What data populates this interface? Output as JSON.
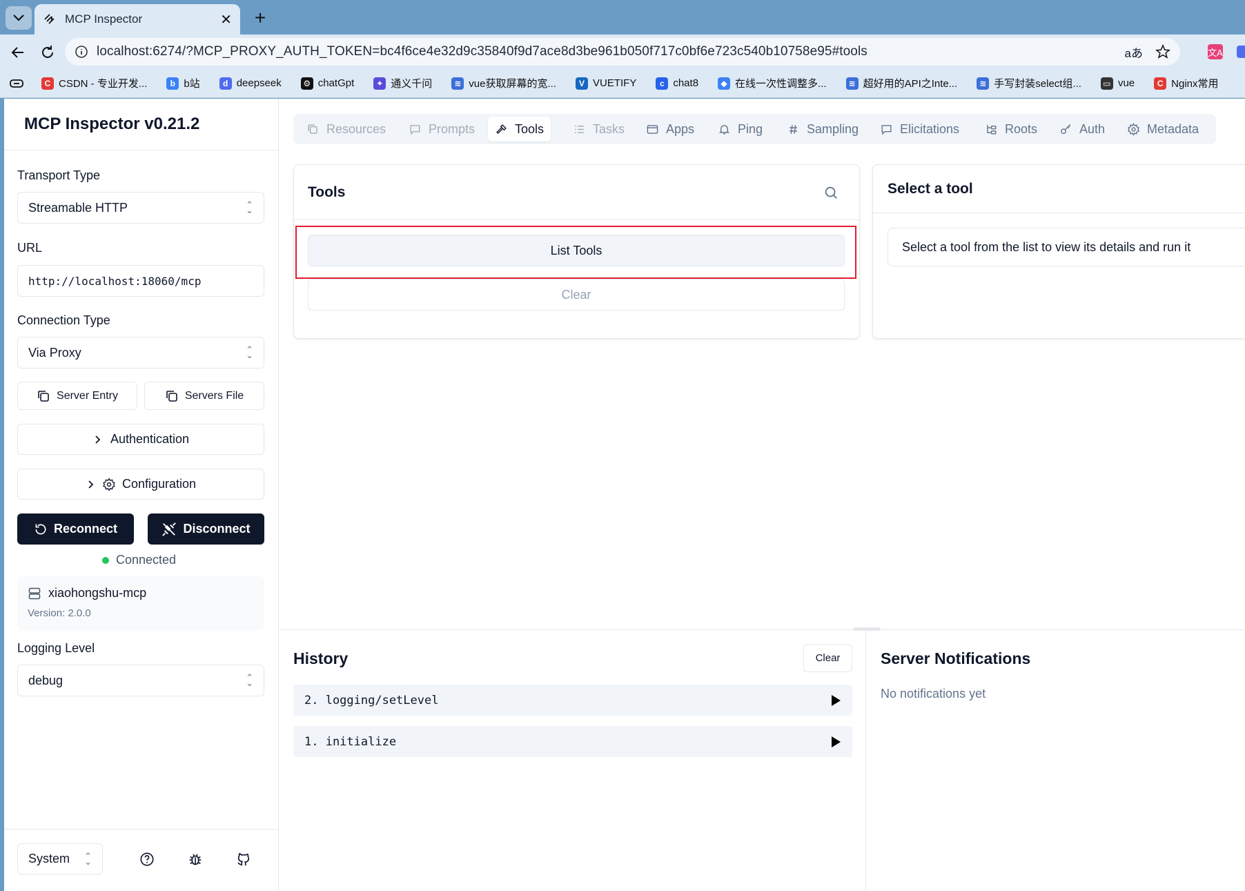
{
  "browser": {
    "tab_title": "MCP Inspector",
    "url": "localhost:6274/?MCP_PROXY_AUTH_TOKEN=bc4f6ce4e32d9c35840f9d7ace8d3be961b050f717c0bf6e723c540b10758e95#tools",
    "bookmarks": [
      {
        "label": "CSDN - 专业开发...",
        "color": "#e53935",
        "glyph": "C"
      },
      {
        "label": "b站",
        "color": "#3b82f6",
        "glyph": "b"
      },
      {
        "label": "deepseek",
        "color": "#4f6bed",
        "glyph": "d"
      },
      {
        "label": "chatGpt",
        "color": "#111111",
        "glyph": "⚙"
      },
      {
        "label": "通义千问",
        "color": "#5b4bdb",
        "glyph": "✦"
      },
      {
        "label": "vue获取屏幕的宽...",
        "color": "#3b6fd9",
        "glyph": "≋"
      },
      {
        "label": "VUETIFY",
        "color": "#1867c0",
        "glyph": "V"
      },
      {
        "label": "chat8",
        "color": "#2563eb",
        "glyph": "c"
      },
      {
        "label": "在线一次性调整多...",
        "color": "#3b82f6",
        "glyph": "◆"
      },
      {
        "label": "超好用的API之Inte...",
        "color": "#3b6fd9",
        "glyph": "≋"
      },
      {
        "label": "手写封装select组...",
        "color": "#3b6fd9",
        "glyph": "≋"
      },
      {
        "label": "vue",
        "color": "#333333",
        "glyph": "▭"
      },
      {
        "label": "Nginx常用",
        "color": "#e53935",
        "glyph": "C"
      }
    ]
  },
  "sidebar": {
    "title": "MCP Inspector v0.21.2",
    "transport_label": "Transport Type",
    "transport_value": "Streamable HTTP",
    "url_label": "URL",
    "url_value": "http://localhost:18060/mcp",
    "connection_label": "Connection Type",
    "connection_value": "Via Proxy",
    "server_entry": "Server Entry",
    "servers_file": "Servers File",
    "authentication": "Authentication",
    "configuration": "Configuration",
    "reconnect": "Reconnect",
    "disconnect": "Disconnect",
    "status": "Connected",
    "status_color": "#22c55e",
    "server_name": "xiaohongshu-mcp",
    "server_version": "Version: 2.0.0",
    "logging_label": "Logging Level",
    "logging_value": "debug",
    "theme_value": "System"
  },
  "main": {
    "tabs": [
      {
        "label": "Resources",
        "icon": "copy-icon"
      },
      {
        "label": "Prompts",
        "icon": "message-icon"
      },
      {
        "label": "Tools",
        "icon": "hammer-icon"
      },
      {
        "label": "Tasks",
        "icon": "list-icon"
      },
      {
        "label": "Apps",
        "icon": "app-window-icon"
      },
      {
        "label": "Ping",
        "icon": "bell-icon"
      },
      {
        "label": "Sampling",
        "icon": "hash-icon"
      },
      {
        "label": "Elicitations",
        "icon": "message-icon"
      },
      {
        "label": "Roots",
        "icon": "folder-tree-icon"
      },
      {
        "label": "Auth",
        "icon": "key-icon"
      },
      {
        "label": "Metadata",
        "icon": "settings-icon"
      }
    ],
    "tools_title": "Tools",
    "list_tools": "List Tools",
    "clear": "Clear",
    "select_title": "Select a tool",
    "select_desc": "Select a tool from the list to view its details and run it"
  },
  "history": {
    "title": "History",
    "clear": "Clear",
    "items": [
      "2. logging/setLevel",
      "1. initialize"
    ]
  },
  "notifications": {
    "title": "Server Notifications",
    "empty": "No notifications yet"
  },
  "colors": {
    "highlight": "#e11d2e",
    "dark": "#0f172a"
  }
}
